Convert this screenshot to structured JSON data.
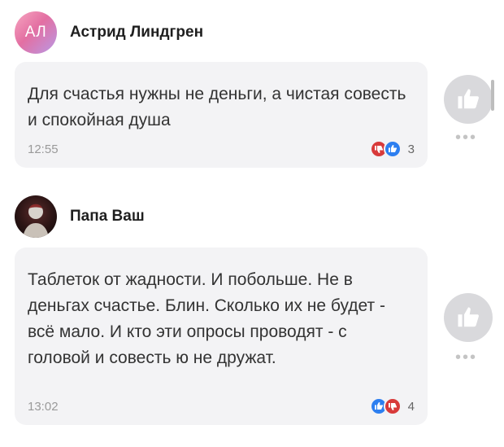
{
  "comments": [
    {
      "avatar_initials": "АЛ",
      "author": "Астрид Линдгрен",
      "text": "Для счастья нужны не деньги, а чистая совесть и спокойная душа",
      "time": "12:55",
      "reactions": [
        "dislike-icon",
        "like-icon"
      ],
      "reaction_count": "3"
    },
    {
      "avatar_initials": "",
      "author": "Папа Ваш",
      "text": "Таблеток от жадности. И побольше. Не в деньгах счастье. Блин. Сколько их не будет - всё мало. И кто эти опросы проводят - с головой и совесть ю не дружат.",
      "time": "13:02",
      "reactions": [
        "like-icon",
        "dislike-icon"
      ],
      "reaction_count": "4"
    }
  ],
  "colors": {
    "bubble": "#f3f3f5",
    "like_blue": "#2d7ff0",
    "dislike_red": "#d83a3a",
    "side_button": "#d9d9dc"
  }
}
